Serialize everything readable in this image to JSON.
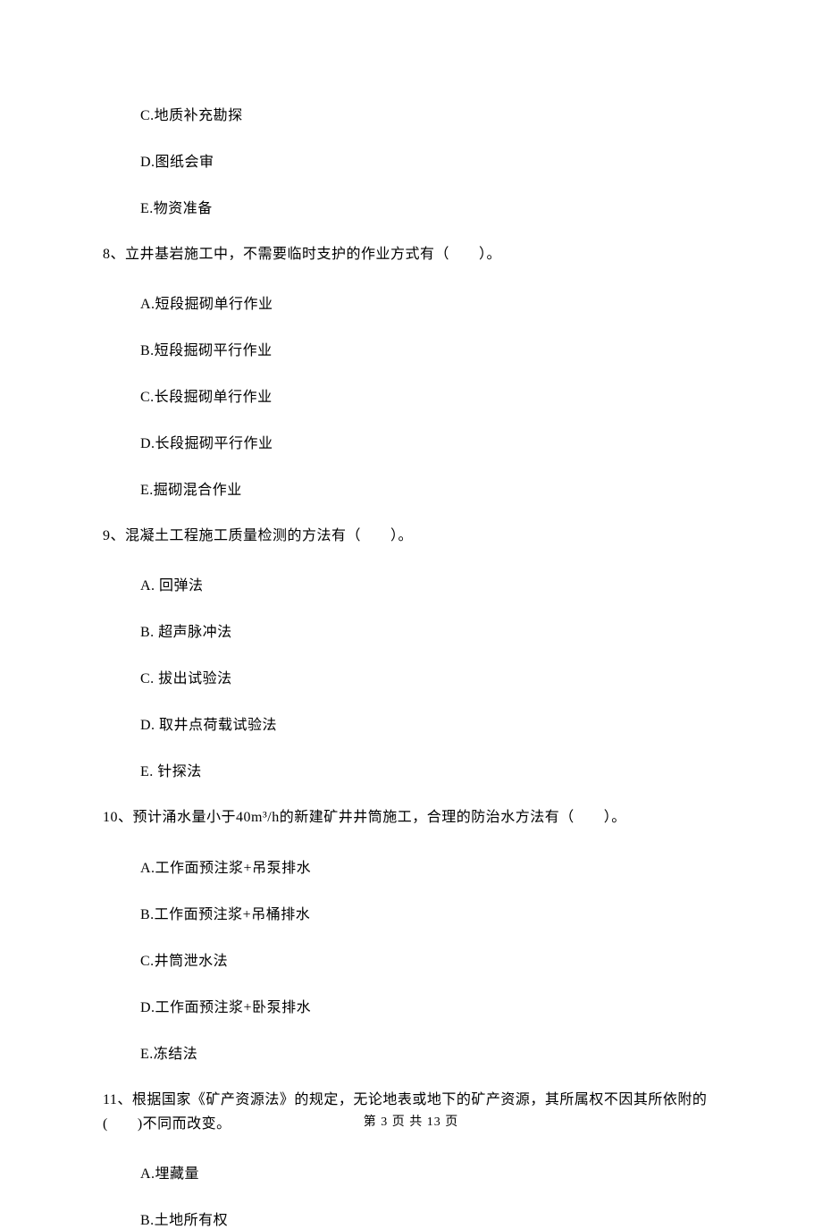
{
  "options_top": {
    "c": "C.地质补充勘探",
    "d": "D.图纸会审",
    "e": "E.物资准备"
  },
  "q8": {
    "stem": "8、立井基岩施工中，不需要临时支护的作业方式有（　　）。",
    "a": "A.短段掘砌单行作业",
    "b": "B.短段掘砌平行作业",
    "c": "C.长段掘砌单行作业",
    "d": "D.长段掘砌平行作业",
    "e": "E.掘砌混合作业"
  },
  "q9": {
    "stem": "9、混凝土工程施工质量检测的方法有（　　）。",
    "a": "A.  回弹法",
    "b": "B.  超声脉冲法",
    "c": "C.  拔出试验法",
    "d": "D.  取井点荷载试验法",
    "e": "E.  针探法"
  },
  "q10": {
    "stem": "10、预计涌水量小于40m³/h的新建矿井井筒施工，合理的防治水方法有（　　）。",
    "a": "A.工作面预注浆+吊泵排水",
    "b": "B.工作面预注浆+吊桶排水",
    "c": "C.井筒泄水法",
    "d": "D.工作面预注浆+卧泵排水",
    "e": "E.冻结法"
  },
  "q11": {
    "stem": "11、根据国家《矿产资源法》的规定，无论地表或地下的矿产资源，其所属权不因其所依附的(　　)不同而改变。",
    "a": "A.埋藏量",
    "b": "B.土地所有权"
  },
  "footer": "第 3 页 共 13 页"
}
